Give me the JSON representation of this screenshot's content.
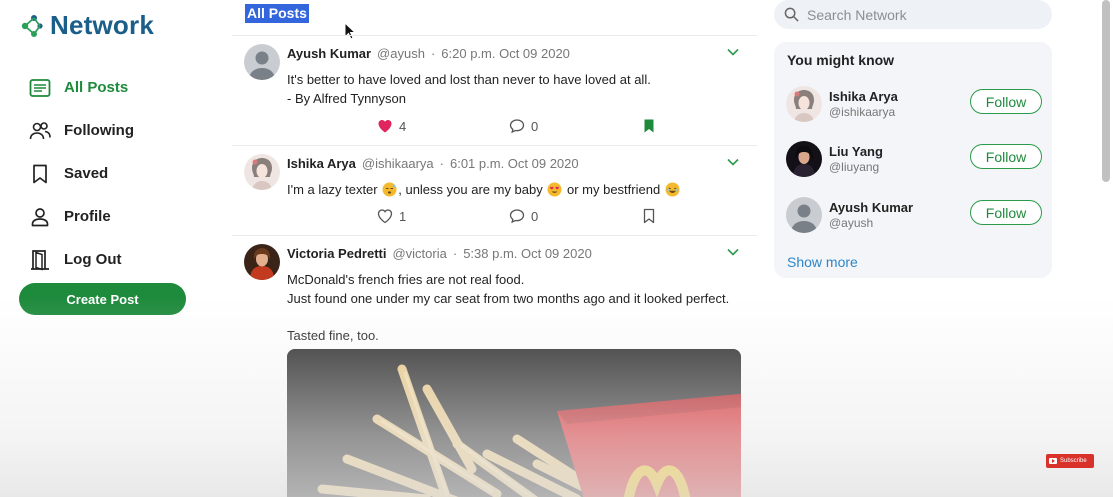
{
  "brand": {
    "name": "Network"
  },
  "nav": {
    "items": [
      {
        "label": "All Posts",
        "icon": "list-icon"
      },
      {
        "label": "Following",
        "icon": "people-icon"
      },
      {
        "label": "Saved",
        "icon": "bookmark-icon"
      },
      {
        "label": "Profile",
        "icon": "person-icon"
      },
      {
        "label": "Log Out",
        "icon": "door-icon"
      }
    ],
    "create_label": "Create Post"
  },
  "feed": {
    "title": "All Posts",
    "posts": [
      {
        "name": "Ayush Kumar",
        "handle": "@ayush",
        "time": "6:20 p.m. Oct 09 2020",
        "lines": [
          "It's better to have loved and lost than never to have loved at all.",
          "- By Alfred Tynnyson"
        ],
        "likes": "4",
        "comments": "0",
        "liked": true,
        "saved": true
      },
      {
        "name": "Ishika Arya",
        "handle": "@ishikaarya",
        "time": "6:01 p.m. Oct 09 2020",
        "text_parts": [
          "I'm a lazy texter ",
          ", unless you are my baby ",
          " or my bestfriend "
        ],
        "likes": "1",
        "comments": "0",
        "liked": false,
        "saved": false
      },
      {
        "name": "Victoria Pedretti",
        "handle": "@victoria",
        "time": "5:38 p.m. Oct 09 2020",
        "lines": [
          "McDonald's french fries are not real food.",
          "Just found one under my car seat from two months ago and it looked perfect.",
          "Tasted fine, too."
        ]
      }
    ]
  },
  "search": {
    "placeholder": "Search Network"
  },
  "suggestions": {
    "title": "You might know",
    "items": [
      {
        "name": "Ishika Arya",
        "handle": "@ishikaarya",
        "button": "Follow"
      },
      {
        "name": "Liu Yang",
        "handle": "@liuyang",
        "button": "Follow"
      },
      {
        "name": "Ayush Kumar",
        "handle": "@ayush",
        "button": "Follow"
      }
    ],
    "show_more": "Show more"
  },
  "overlay": {
    "youtube_badge": "Subscribe"
  },
  "colors": {
    "accent": "#1e8a3c",
    "brand": "#1b5e8a",
    "link": "#2f86c8",
    "like": "#e0245e"
  }
}
